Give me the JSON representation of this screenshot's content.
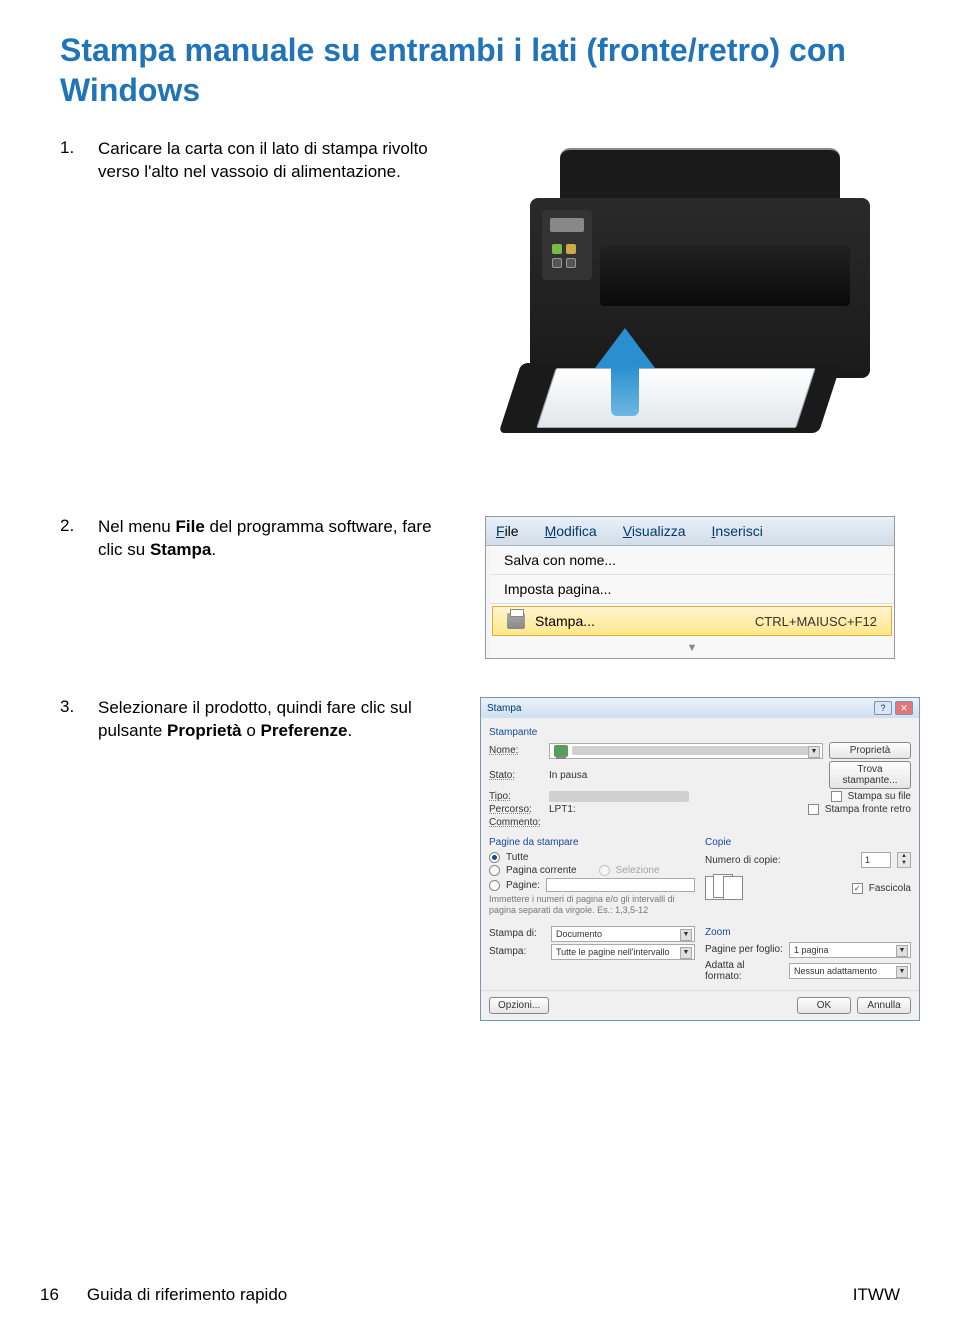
{
  "title_line1": "Stampa manuale su entrambi i lati (fronte/retro) con",
  "title_line2": "Windows",
  "steps": {
    "s1": {
      "num": "1.",
      "text": "Caricare la carta con il lato di stampa rivolto verso l'alto nel vassoio di alimentazione."
    },
    "s2": {
      "num": "2.",
      "pre": "Nel menu ",
      "b1": "File",
      "mid": " del programma software, fare clic su ",
      "b2": "Stampa",
      "post": "."
    },
    "s3": {
      "num": "3.",
      "pre": "Selezionare il prodotto, quindi fare clic sul pulsante ",
      "b1": "Proprietà",
      "mid": " o ",
      "b2": "Preferenze",
      "post": "."
    }
  },
  "menu": {
    "file": "File",
    "modifica": "Modifica",
    "visualizza": "Visualizza",
    "inserisci": "Inserisci",
    "salva": "Salva con nome...",
    "imposta": "Imposta pagina...",
    "stampa": "Stampa...",
    "shortcut": "CTRL+MAIUSC+F12",
    "chev": "▼"
  },
  "dialog": {
    "title": "Stampa",
    "grp_printer": "Stampante",
    "nome": "Nome:",
    "stato": "Stato:",
    "stato_val": "In pausa",
    "tipo": "Tipo:",
    "percorso": "Percorso:",
    "percorso_val": "LPT1:",
    "commento": "Commento:",
    "btn_prop": "Proprietà",
    "btn_trova": "Trova stampante...",
    "chk_file": "Stampa su file",
    "chk_fr": "Stampa fronte retro",
    "grp_pagine": "Pagine da stampare",
    "tutte": "Tutte",
    "corrente": "Pagina corrente",
    "selezione": "Selezione",
    "pagine": "Pagine:",
    "hint": "Immettere i numeri di pagina e/o gli intervalli di pagina separati da virgole. Es.: 1,3,5-12",
    "grp_copie": "Copie",
    "num_copie": "Numero di copie:",
    "copie_val": "1",
    "fascicola": "Fascicola",
    "stampa_di": "Stampa di:",
    "stampa_di_val": "Documento",
    "stampa": "Stampa:",
    "stampa_val": "Tutte le pagine nell'intervallo",
    "grp_zoom": "Zoom",
    "pag_foglio": "Pagine per foglio:",
    "pag_foglio_val": "1 pagina",
    "adatta": "Adatta al formato:",
    "adatta_val": "Nessun adattamento",
    "btn_opzioni": "Opzioni...",
    "btn_ok": "OK",
    "btn_annulla": "Annulla"
  },
  "footer": {
    "page": "16",
    "doc": "Guida di riferimento rapido",
    "code": "ITWW"
  }
}
